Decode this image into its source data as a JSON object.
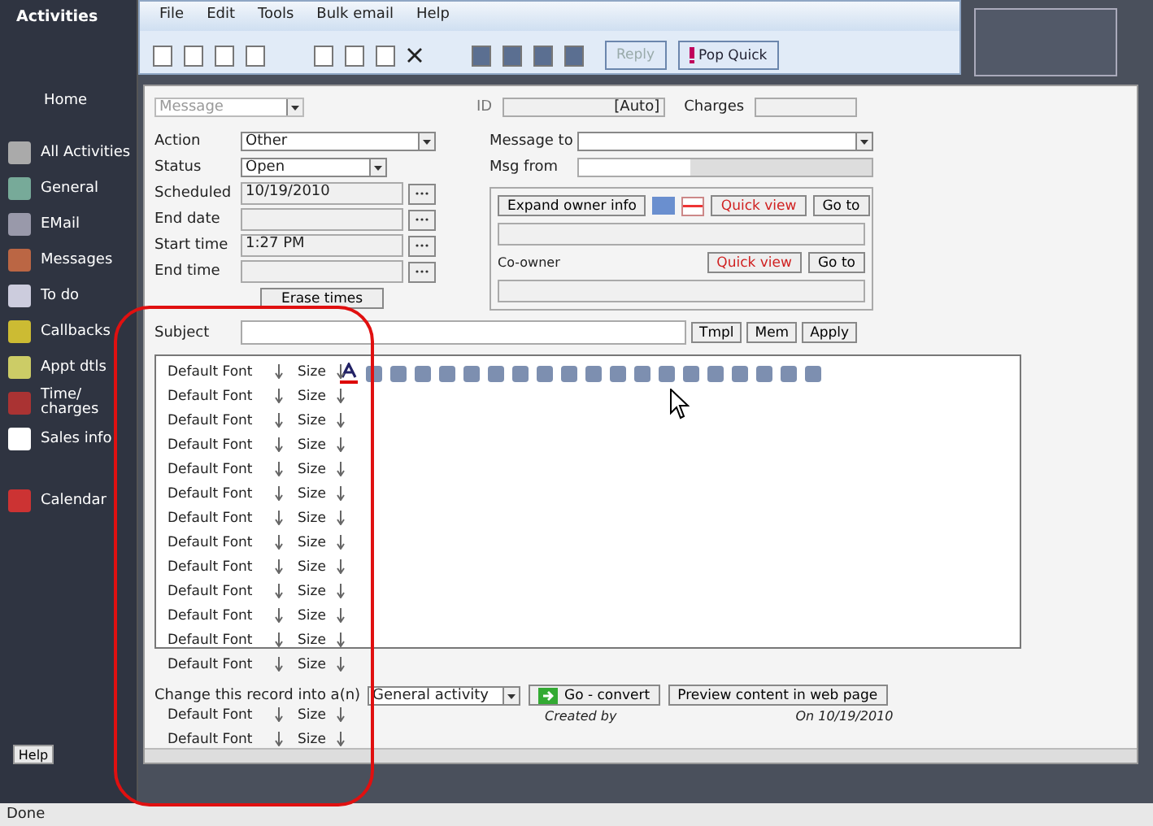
{
  "sidebar": {
    "title": "Activities",
    "items": [
      {
        "label": "Home",
        "has_icon": false
      },
      {
        "label": "All Activities",
        "has_icon": true
      },
      {
        "label": "General",
        "has_icon": true
      },
      {
        "label": "EMail",
        "has_icon": true
      },
      {
        "label": "Messages",
        "has_icon": true
      },
      {
        "label": "To do",
        "has_icon": true
      },
      {
        "label": "Callbacks",
        "has_icon": true
      },
      {
        "label": "Appt dtls",
        "has_icon": true
      },
      {
        "label": "Time/ charges",
        "has_icon": true
      },
      {
        "label": "Sales info",
        "has_icon": true
      },
      {
        "label": "Calendar",
        "has_icon": true
      }
    ],
    "help_button": "Help"
  },
  "menu": [
    "File",
    "Edit",
    "Tools",
    "Bulk email",
    "Help"
  ],
  "toolbar": {
    "reply_button": {
      "label": "Reply",
      "disabled": true
    },
    "pop_quick_button": "Pop Quick"
  },
  "form": {
    "type_select": {
      "value": "Message",
      "disabled": true
    },
    "id": {
      "label": "ID",
      "value": "[Auto]"
    },
    "charges": {
      "label": "Charges"
    },
    "fields": [
      {
        "label": "Action",
        "kind": "select",
        "value": "Other"
      },
      {
        "label": "Status",
        "kind": "select",
        "value": "Open"
      },
      {
        "label": "Scheduled",
        "kind": "picker",
        "value": "10/19/2010"
      },
      {
        "label": "End date",
        "kind": "picker"
      },
      {
        "label": "Start time",
        "kind": "picker",
        "value": "1:27 PM"
      },
      {
        "label": "End time",
        "kind": "picker"
      }
    ],
    "erase_button": "Erase times",
    "message_to": {
      "label": "Message to"
    },
    "msg_from": {
      "label": "Msg from"
    },
    "owner": {
      "expand_button": "Expand owner info",
      "quick_view": "Quick view",
      "goto": "Go to"
    },
    "co_owner": {
      "label": "Co-owner",
      "quick_view": "Quick view",
      "goto": "Go to"
    },
    "subject": {
      "label": "Subject",
      "buttons": [
        "Tmpl",
        "Mem",
        "Apply"
      ]
    },
    "convert": {
      "label": "Change this record into a(n)",
      "select": "General activity",
      "go_button": "Go - convert",
      "preview_button": "Preview content in web page"
    },
    "created_by": "Created by",
    "created_on": "On 10/19/2010"
  },
  "font_list": [
    {
      "font": "Default Font",
      "size": "Size"
    },
    {
      "font": "Default Font",
      "size": "Size"
    },
    {
      "font": "Default Font",
      "size": "Size"
    },
    {
      "font": "Default Font",
      "size": "Size"
    },
    {
      "font": "Default Font",
      "size": "Size"
    },
    {
      "font": "Default Font",
      "size": "Size"
    },
    {
      "font": "Default Font",
      "size": "Size"
    },
    {
      "font": "Default Font",
      "size": "Size"
    },
    {
      "font": "Default Font",
      "size": "Size"
    },
    {
      "font": "Default Font",
      "size": "Size"
    },
    {
      "font": "Default Font",
      "size": "Size"
    },
    {
      "font": "Default Font",
      "size": "Size"
    },
    {
      "font": "Default Font",
      "size": "Size"
    },
    {
      "font": "Default Font",
      "size": "Size"
    },
    {
      "font": "Default Font",
      "size": "Size"
    }
  ],
  "status_bar": "Done"
}
